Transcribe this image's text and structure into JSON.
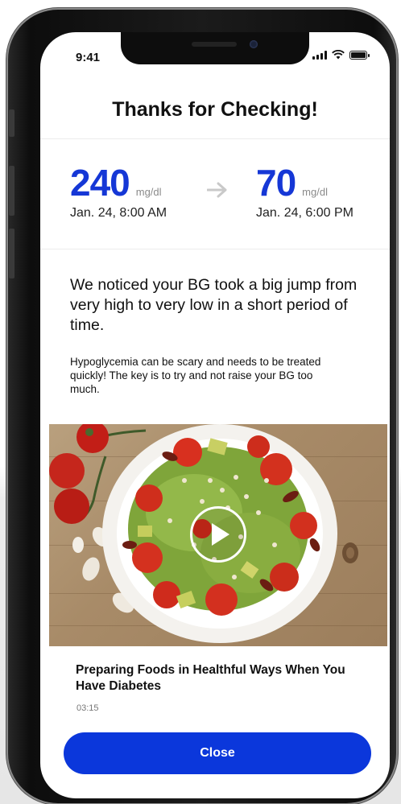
{
  "status_bar": {
    "time": "9:41"
  },
  "header": {
    "title": "Thanks for Checking!"
  },
  "readings": [
    {
      "value": "240",
      "unit": "mg/dl",
      "time": "Jan. 24, 8:00 AM"
    },
    {
      "value": "70",
      "unit": "mg/dl",
      "time": "Jan. 24, 6:00 PM"
    }
  ],
  "message": {
    "headline": "We noticed your BG took a  big jump from very high to very low in a short period of time.",
    "body": "Hypoglycemia can be scary and needs to be treated quickly! The key is to try and not raise your BG too much."
  },
  "video": {
    "title": "Preparing Foods in Healthful Ways When You Have Diabetes",
    "duration": "03:15"
  },
  "actions": {
    "close_label": "Close"
  },
  "colors": {
    "accent": "#1537d6",
    "button": "#0b37db"
  }
}
